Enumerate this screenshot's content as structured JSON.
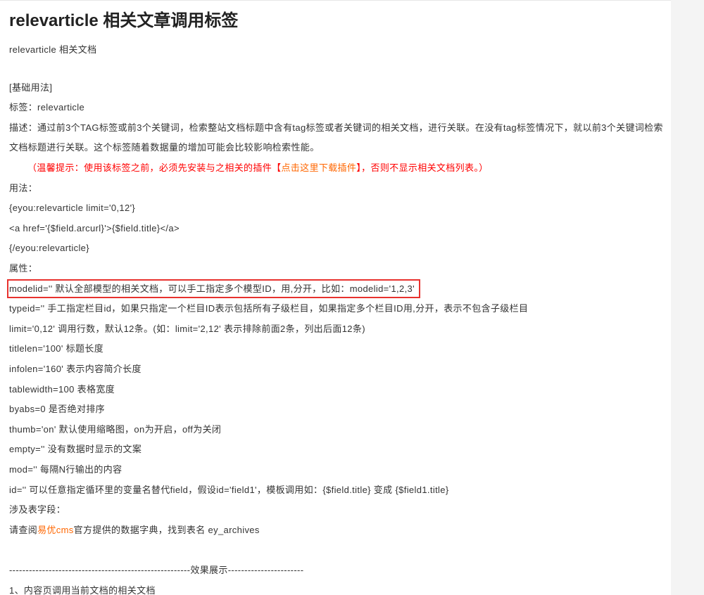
{
  "doc": {
    "title": "relevarticle 相关文章调用标签",
    "subtitle": "relevarticle 相关文档",
    "basic_usage_heading": "[基础用法]",
    "tag_line": "标签：relevarticle",
    "description": [
      "描述：通过前3个TAG标签或前3个关键词，检索整站文档标题中含有tag标签或者关键词的相关文档，进行关联。在没有tag标签情况下，就以前3个关键词检索",
      "文档标题进行关联。这个标签随着数据量的增加可能会比较影响检索性能。"
    ],
    "notice": {
      "before": "（温馨提示：使用该标签之前，必须先安装与之相关的插件【",
      "link": "点击这里下载插件",
      "after": "】，否则不显示相关文档列表。）"
    },
    "usage_heading": "用法：",
    "usage_code": [
      "{eyou:relevarticle limit='0,12'}",
      "<a href='{$field.arcurl}'>{$field.title}</a>",
      "{/eyou:relevarticle}"
    ],
    "attributes_heading": "属性：",
    "attributes": [
      "modelid='' 默认全部模型的相关文档，可以手工指定多个模型ID，用,分开，比如：modelid='1,2,3'",
      "typeid='' 手工指定栏目id，如果只指定一个栏目ID表示包括所有子级栏目，如果指定多个栏目ID用,分开，表示不包含子级栏目",
      "limit='0,12' 调用行数，默认12条。(如：limit='2,12' 表示排除前面2条，列出后面12条)",
      "titlelen='100' 标题长度",
      "infolen='160' 表示内容简介长度",
      "tablewidth=100 表格宽度",
      "byabs=0 是否绝对排序",
      "thumb='on' 默认使用缩略图，on为开启，off为关闭",
      "empty='' 没有数据时显示的文案",
      "mod='' 每隔N行输出的内容",
      "id='' 可以任意指定循环里的变量名替代field，假设id='field1'，模板调用如：{$field.title} 变成 {$field1.title}"
    ],
    "fields_heading": "涉及表字段：",
    "fields_note": {
      "before": "请查阅",
      "link": "易优cms",
      "after": "官方提供的数据字典，找到表名 ey_archives"
    },
    "separator": "-------------------------------------------------------效果展示-----------------------",
    "example_heading": "1、内容页调用当前文档的相关文档"
  },
  "colors": {
    "text": "#333333",
    "title": "#222222",
    "notice": "#ff0000",
    "link": "#ff6600",
    "highlight_border": "#e8322e",
    "sidebar": "#f4f4f4"
  }
}
